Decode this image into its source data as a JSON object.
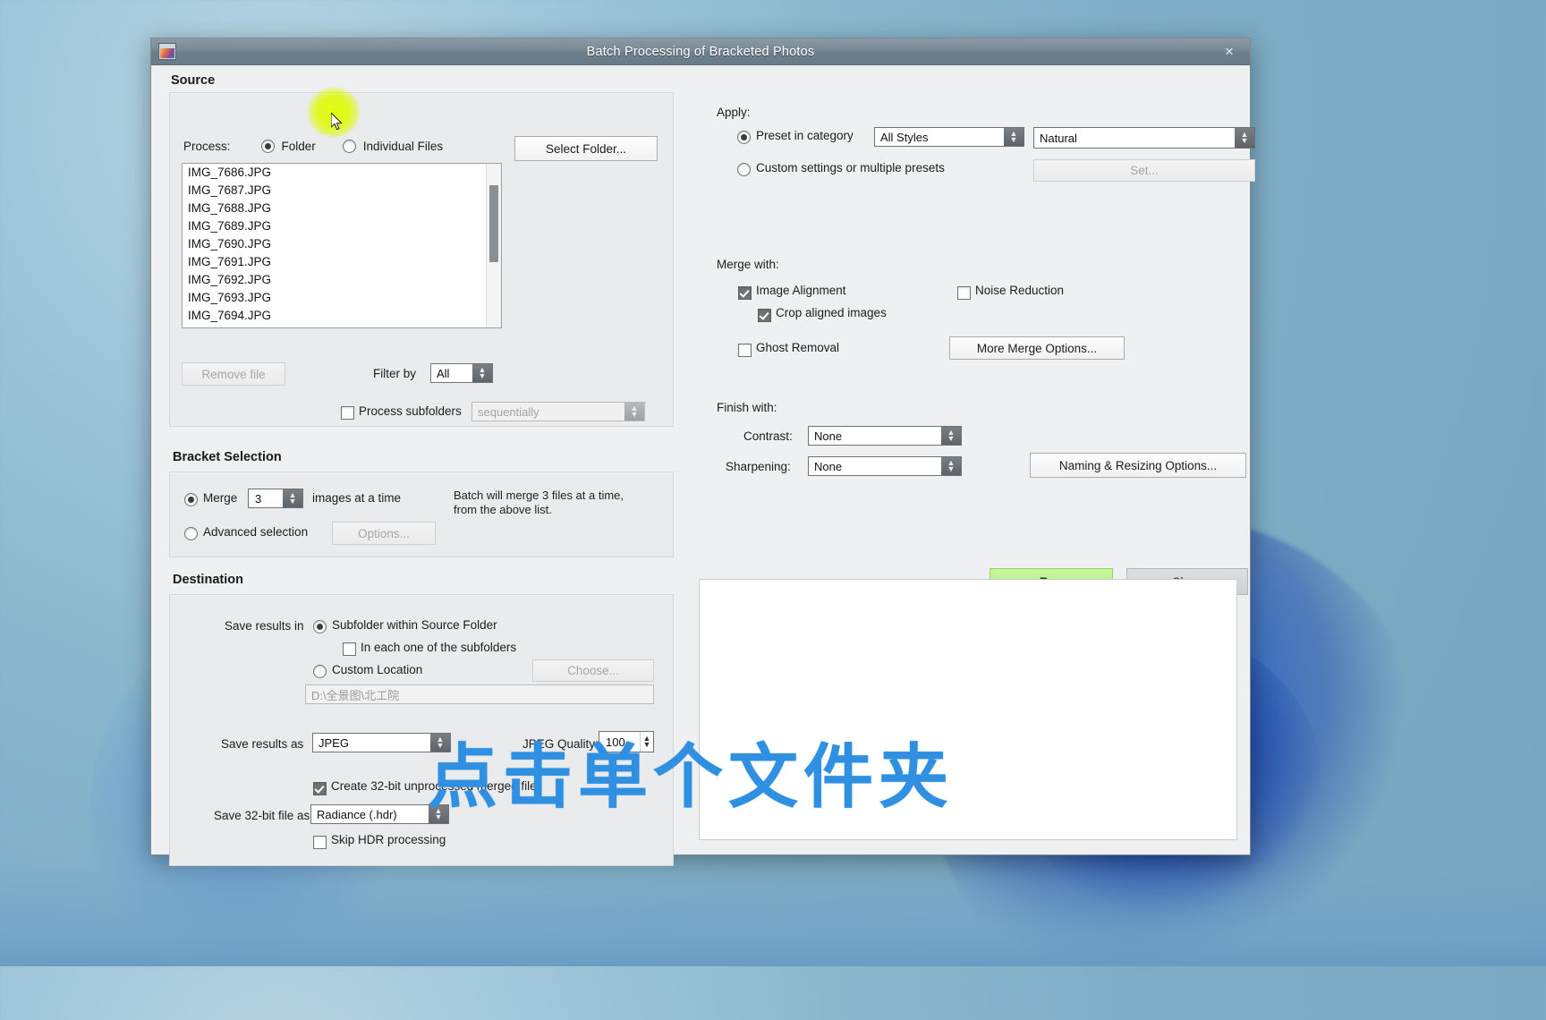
{
  "window": {
    "title": "Batch Processing of Bracketed Photos",
    "close_label": "×",
    "app_icon": "photomatix-icon"
  },
  "source": {
    "group_title": "Source",
    "process_label": "Process:",
    "radio_folder": "Folder",
    "radio_individual": "Individual Files",
    "select_folder_button": "Select Folder...",
    "files": [
      "IMG_7686.JPG",
      "IMG_7687.JPG",
      "IMG_7688.JPG",
      "IMG_7689.JPG",
      "IMG_7690.JPG",
      "IMG_7691.JPG",
      "IMG_7692.JPG",
      "IMG_7693.JPG",
      "IMG_7694.JPG"
    ],
    "remove_file_button": "Remove file",
    "filter_by_label": "Filter by",
    "filter_by_value": "All",
    "process_subfolders_label": "Process subfolders",
    "process_subfolders_order": "sequentially"
  },
  "bracket": {
    "group_title": "Bracket Selection",
    "merge_label": "Merge",
    "merge_count": "3",
    "merge_suffix": "images at a time",
    "advanced_label": "Advanced selection",
    "options_button": "Options...",
    "hint_line1": "Batch will merge 3 files at a time,",
    "hint_line2": "from the above list."
  },
  "destination": {
    "group_title": "Destination",
    "save_results_in_label": "Save results in",
    "subfolder_option": "Subfolder within Source Folder",
    "each_subfolder_option": "In each one of the subfolders",
    "custom_location_option": "Custom Location",
    "choose_button": "Choose...",
    "custom_path": "D:\\全景图\\北工院",
    "save_results_as_label": "Save results as",
    "save_results_as_value": "JPEG",
    "jpeg_quality_label": "JPEG Quality:",
    "jpeg_quality_value": "100",
    "create_32bit_label": "Create 32-bit unprocessed merged file",
    "save_32bit_label": "Save 32-bit file as",
    "save_32bit_value": "Radiance (.hdr)",
    "skip_hdr_label": "Skip HDR processing"
  },
  "apply": {
    "section_label": "Apply:",
    "preset_in_category_label": "Preset in category",
    "category_value": "All Styles",
    "preset_value": "Natural",
    "custom_settings_label": "Custom settings or multiple presets",
    "set_button": "Set..."
  },
  "merge_with": {
    "section_label": "Merge with:",
    "image_alignment_label": "Image Alignment",
    "crop_aligned_label": "Crop aligned images",
    "noise_reduction_label": "Noise Reduction",
    "ghost_removal_label": "Ghost Removal",
    "more_merge_options_button": "More Merge Options..."
  },
  "finish_with": {
    "section_label": "Finish with:",
    "contrast_label": "Contrast:",
    "contrast_value": "None",
    "sharpening_label": "Sharpening:",
    "sharpening_value": "None",
    "naming_resizing_button": "Naming & Resizing Options..."
  },
  "actions": {
    "run_button": "Run",
    "close_button": "Close"
  },
  "overlay": {
    "annotation_text": "点击单个文件夹"
  },
  "colors": {
    "run_button": "#aeee7c",
    "titlebar": "#6d7e8b",
    "highlight": "#def a00",
    "annotation": "#2f8fe0"
  }
}
